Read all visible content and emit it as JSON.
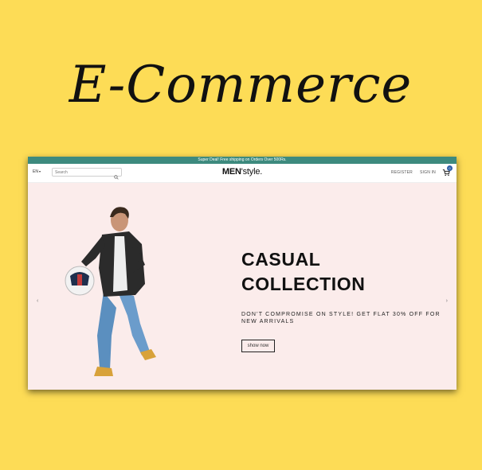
{
  "poster": {
    "title": "E-Commerce"
  },
  "colors": {
    "background": "#fddc56",
    "promo_bar": "#3d8a7e",
    "slide_bg": "#fbeceb",
    "cart_badge": "#2f5fa8"
  },
  "topbar": {
    "promo": "Super Deal! Free shipping on Orders Over 500Rs."
  },
  "header": {
    "language": "EN",
    "search_placeholder": "Search",
    "brand_bold": "MEN",
    "brand_rest": "'style.",
    "register": "REGISTER",
    "sign_in": "SIGN IN",
    "cart_count": "0"
  },
  "slide": {
    "heading_line1": "CASUAL",
    "heading_line2": "COLLECTION",
    "subtitle": "DON'T COMPROMISE ON STYLE! GET FLAT 30% OFF FOR NEW ARRIVALS",
    "button": "show now",
    "prev_arrow": "‹",
    "next_arrow": "›"
  },
  "icons": [
    "search-icon",
    "cart-icon",
    "chevron-down-icon",
    "chevron-left-icon",
    "chevron-right-icon"
  ]
}
